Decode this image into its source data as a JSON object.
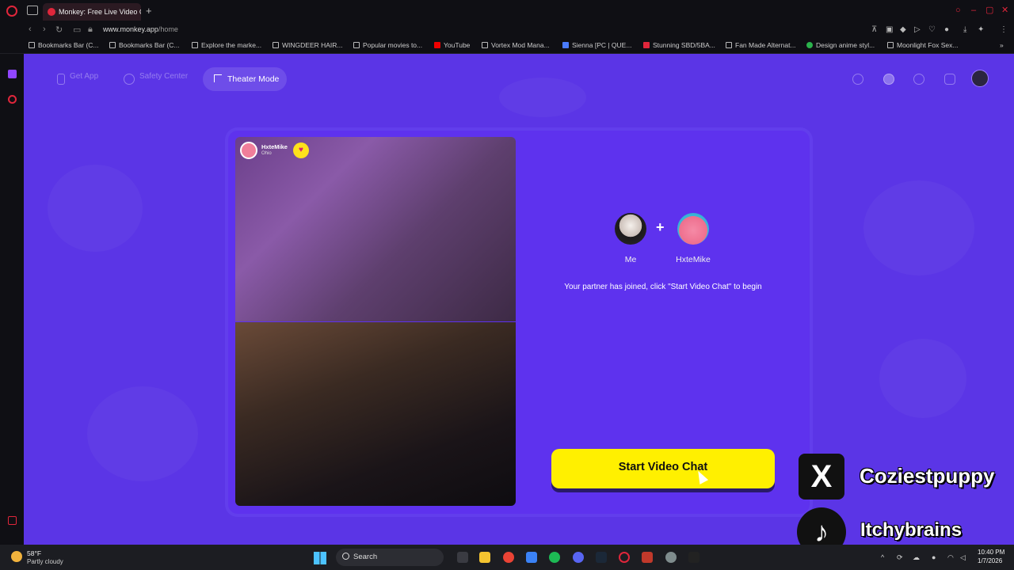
{
  "browser": {
    "tab_title": "Monkey: Free Live Video C",
    "url_domain": "www.monkey.app",
    "url_path": "/home",
    "bookmarks": [
      "Bookmarks Bar (C...",
      "Bookmarks Bar (C...",
      "Explore the marke...",
      "WINGDEER HAIR...",
      "Popular movies to...",
      "YouTube",
      "Vortex Mod Mana...",
      "Sienna [PC | QUE...",
      "Stunning SBD/5BA...",
      "Fan Made Alternat...",
      "Design anime styl...",
      "Moonlight Fox Sex..."
    ]
  },
  "nav": {
    "get_app": "Get App",
    "safety_center": "Safety Center",
    "theater_mode": "Theater Mode"
  },
  "partner": {
    "name": "HxteMike",
    "location": "Ohio"
  },
  "panel": {
    "me_label": "Me",
    "partner_label": "HxteMike",
    "message": "Your partner has joined, click \"Start Video Chat\" to begin",
    "start_button": "Start Video Chat"
  },
  "overlay": {
    "x_handle": "Coziestpuppy",
    "tiktok_handle": "Itchybrains"
  },
  "taskbar": {
    "temperature": "58°F",
    "weather": "Partly cloudy",
    "search_label": "Search",
    "time": "10:40 PM",
    "date": "1/7/2026"
  },
  "colors": {
    "page_bg": "#5b35e6",
    "start_button": "#fff000",
    "accent": "#e0263b"
  }
}
